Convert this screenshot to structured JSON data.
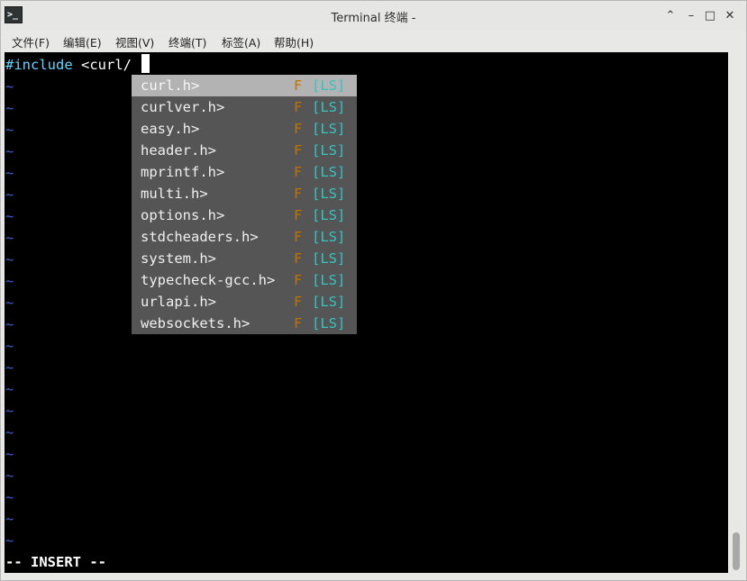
{
  "window": {
    "title": "Terminal 终端 -"
  },
  "menu": [
    {
      "label": "文件(F)"
    },
    {
      "label": "编辑(E)"
    },
    {
      "label": "视图(V)"
    },
    {
      "label": "终端(T)"
    },
    {
      "label": "标签(A)"
    },
    {
      "label": "帮助(H)"
    }
  ],
  "editor": {
    "line1_keyword": "#include",
    "line1_rest": " <curl/",
    "tilde": "~",
    "mode": "-- INSERT --"
  },
  "completion": [
    {
      "name": "curl.h>",
      "kind": "F",
      "source": "[LS]"
    },
    {
      "name": "curlver.h>",
      "kind": "F",
      "source": "[LS]"
    },
    {
      "name": "easy.h>",
      "kind": "F",
      "source": "[LS]"
    },
    {
      "name": "header.h>",
      "kind": "F",
      "source": "[LS]"
    },
    {
      "name": "mprintf.h>",
      "kind": "F",
      "source": "[LS]"
    },
    {
      "name": "multi.h>",
      "kind": "F",
      "source": "[LS]"
    },
    {
      "name": "options.h>",
      "kind": "F",
      "source": "[LS]"
    },
    {
      "name": "stdcheaders.h>",
      "kind": "F",
      "source": "[LS]"
    },
    {
      "name": "system.h>",
      "kind": "F",
      "source": "[LS]"
    },
    {
      "name": "typecheck-gcc.h>",
      "kind": "F",
      "source": "[LS]"
    },
    {
      "name": "urlapi.h>",
      "kind": "F",
      "source": "[LS]"
    },
    {
      "name": "websockets.h>",
      "kind": "F",
      "source": "[LS]"
    }
  ],
  "colors": {
    "keyword": "#5fd7ff",
    "tilde": "#3b63d0",
    "popup_bg": "#555555",
    "popup_selected": "#b3b3b3",
    "kind": "#c27200",
    "source": "#33c4c4"
  }
}
